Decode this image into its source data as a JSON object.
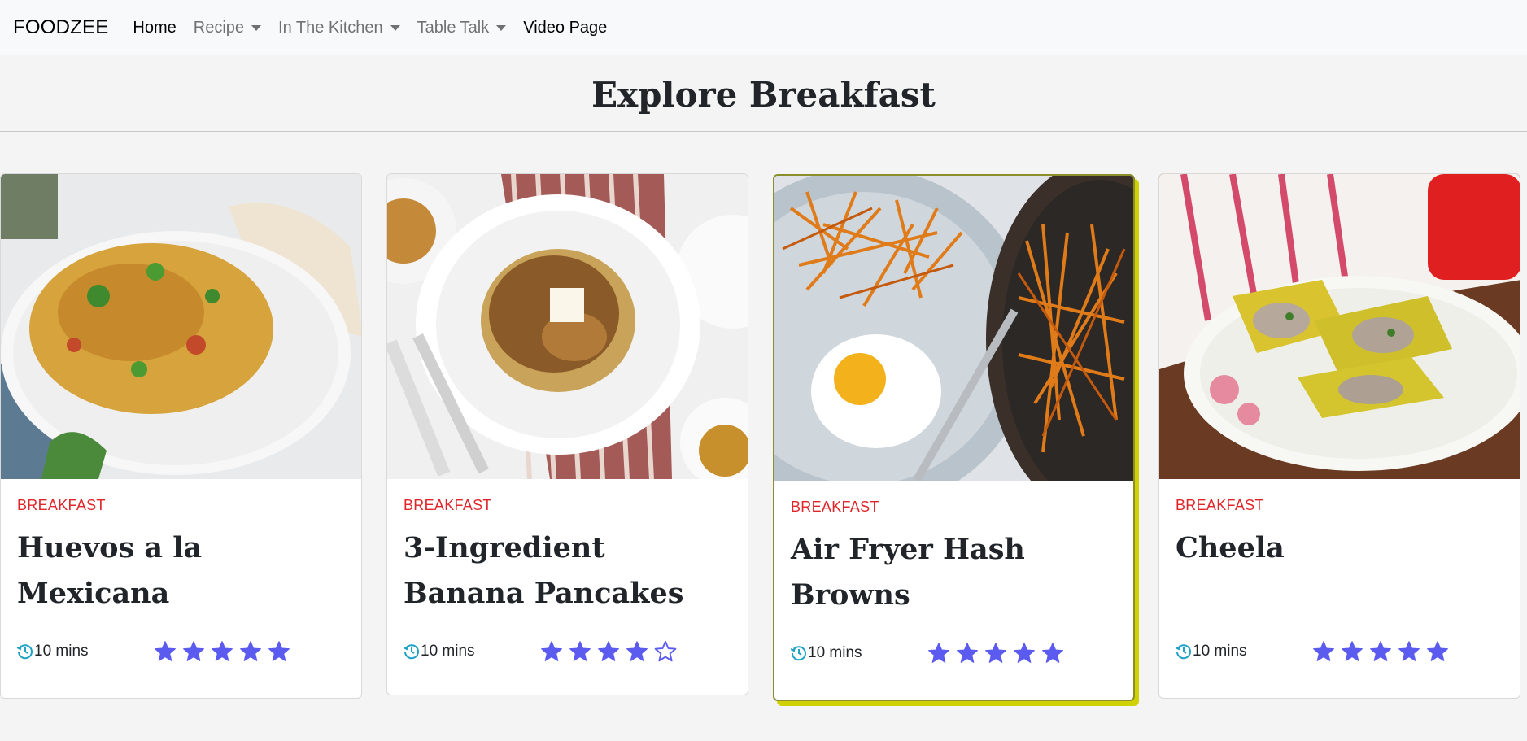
{
  "nav": {
    "brand": "FOODZEE",
    "items": [
      {
        "label": "Home",
        "dropdown": false,
        "active": true
      },
      {
        "label": "Recipe",
        "dropdown": true,
        "active": false
      },
      {
        "label": "In The Kitchen",
        "dropdown": true,
        "active": false
      },
      {
        "label": "Table Talk",
        "dropdown": true,
        "active": false
      },
      {
        "label": "Video Page",
        "dropdown": false,
        "active": true
      }
    ]
  },
  "page": {
    "title": "Explore Breakfast"
  },
  "cards": [
    {
      "category": "BREAKFAST",
      "title": "Huevos a la Mexicana",
      "time": "10 mins",
      "rating": 5
    },
    {
      "category": "BREAKFAST",
      "title": "3-Ingredient Banana Pancakes",
      "time": "10 mins",
      "rating": 4
    },
    {
      "category": "BREAKFAST",
      "title": "Air Fryer Hash Browns",
      "time": "10 mins",
      "rating": 5
    },
    {
      "category": "BREAKFAST",
      "title": "Cheela",
      "time": "10 mins",
      "rating": 5
    }
  ],
  "colors": {
    "category": "#e0262b",
    "star": "#5b5bf0",
    "clock": "#1fa3c4",
    "highlight_shadow": "#cfd100"
  },
  "icons": {
    "clock": "history-clock-icon",
    "star_filled": "star-filled-icon",
    "star_empty": "star-outline-icon",
    "caret": "caret-down-icon"
  }
}
